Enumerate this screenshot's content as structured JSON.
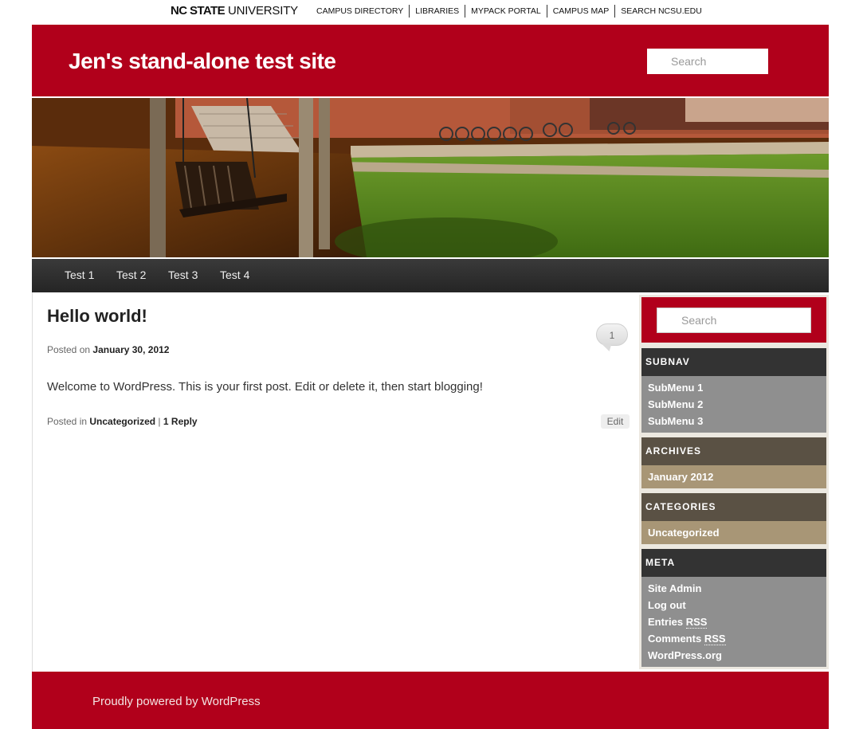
{
  "utility": {
    "logo_bold": "NC STATE",
    "logo_rest": "UNIVERSITY",
    "links": [
      "CAMPUS DIRECTORY",
      "LIBRARIES",
      "MYPACK PORTAL",
      "CAMPUS MAP",
      "SEARCH NCSU.EDU"
    ]
  },
  "header": {
    "site_title": "Jen's stand-alone test site",
    "search_placeholder": "Search",
    "accent_color": "#b1001b"
  },
  "banner": {
    "description_icon": "campus-photo"
  },
  "nav": {
    "items": [
      "Test 1",
      "Test 2",
      "Test 3",
      "Test 4"
    ]
  },
  "post": {
    "title": "Hello world!",
    "comment_count": "1",
    "posted_on_label": "Posted on",
    "date": "January 30, 2012",
    "body": "Welcome to WordPress. This is your first post. Edit or delete it, then start blogging!",
    "posted_in_label": "Posted in",
    "category": "Uncategorized",
    "separator": "|",
    "reply_link": "1 Reply",
    "edit_label": "Edit"
  },
  "sidebar": {
    "search_placeholder": "Search",
    "subnav": {
      "title": "SUBNAV",
      "items": [
        "SubMenu 1",
        "SubMenu 2",
        "SubMenu 3"
      ]
    },
    "archives": {
      "title": "ARCHIVES",
      "items": [
        "January 2012"
      ]
    },
    "categories": {
      "title": "CATEGORIES",
      "items": [
        "Uncategorized"
      ]
    },
    "meta": {
      "title": "META",
      "items": [
        "Site Admin",
        "Log out",
        "Entries",
        "Comments",
        "WordPress.org"
      ],
      "rss": "RSS"
    }
  },
  "footer": {
    "text": "Proudly powered by WordPress"
  }
}
